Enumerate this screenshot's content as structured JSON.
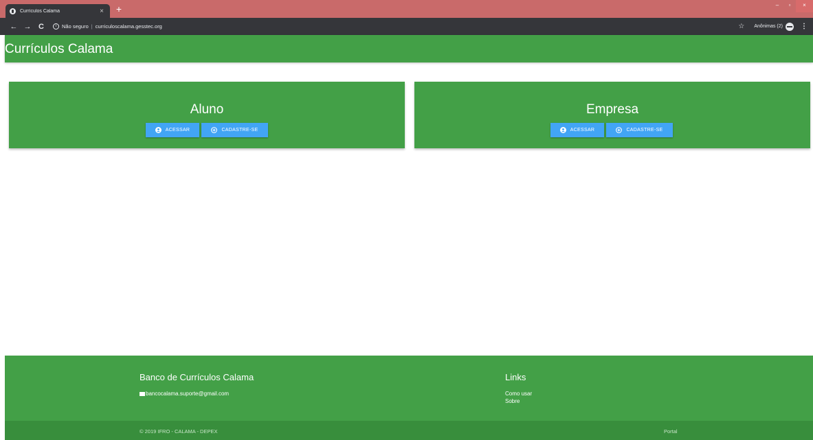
{
  "browser": {
    "tab_title": "Currículos Calama",
    "tab_close": "×",
    "new_tab": "+",
    "nav_back": "←",
    "nav_forward": "→",
    "nav_reload": "C",
    "security_label": "Não seguro",
    "url_separator": "|",
    "url": "curriculoscalama.gesstec.org",
    "bookmark_icon": "☆",
    "incognito_label": "Anônimas (2)",
    "menu_icon": "⋮",
    "window_minimize": "–",
    "window_maximize": "▫",
    "window_close": "×"
  },
  "app": {
    "brand": "Currículos Calama"
  },
  "cards": {
    "aluno": {
      "title": "Aluno",
      "acessar_label": "ACESSAR",
      "cadastrar_label": "CADASTRE-SE"
    },
    "empresa": {
      "title": "Empresa",
      "acessar_label": "ACESSAR",
      "cadastrar_label": "CADASTRE-SE"
    }
  },
  "footer": {
    "title": "Banco de Currículos Calama",
    "email": "bancocalama.suporte@gmail.com",
    "links_title": "Links",
    "links": [
      "Como usar",
      "Sobre"
    ],
    "copyright": "© 2019 IFRO - CALAMA - DEPEX",
    "portal": "Portal"
  },
  "colors": {
    "primary_green": "#43a047",
    "dark_green": "#388e3c",
    "button_blue": "#42a5f5",
    "tabstrip": "#c96a6a",
    "chrome_dark": "#35363a"
  }
}
